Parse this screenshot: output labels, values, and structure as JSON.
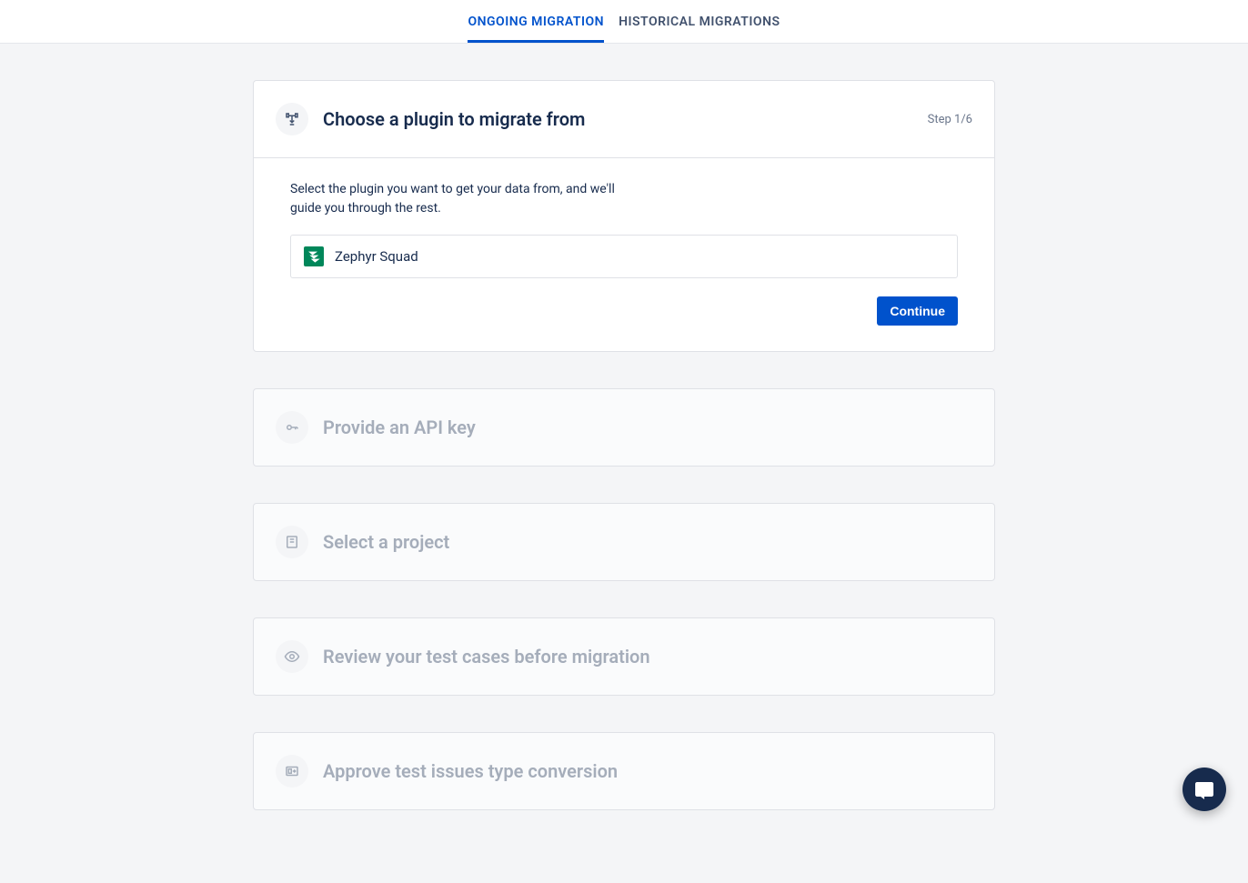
{
  "tabs": {
    "ongoing": "ONGOING MIGRATION",
    "historical": "HISTORICAL MIGRATIONS"
  },
  "step1": {
    "title": "Choose a plugin to migrate from",
    "counter": "Step 1/6",
    "description": "Select the plugin you want to get your data from, and we'll guide you through the rest.",
    "selected_plugin": "Zephyr Squad",
    "continue_label": "Continue"
  },
  "step2": {
    "title": "Provide an API key"
  },
  "step3": {
    "title": "Select a project"
  },
  "step4": {
    "title": "Review your test cases before migration"
  },
  "step5": {
    "title": "Approve test issues type conversion"
  }
}
